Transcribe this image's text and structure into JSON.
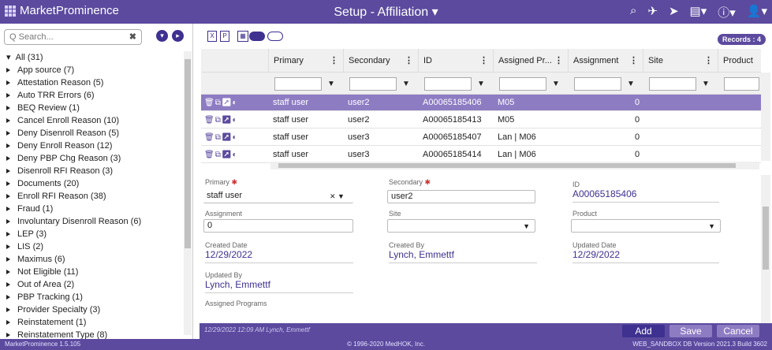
{
  "app": {
    "name": "MarketProminence",
    "page_title": "Setup - Affiliation"
  },
  "search": {
    "placeholder": "Q Search..."
  },
  "tree": {
    "root": "All (31)",
    "items": [
      "App source (7)",
      "Attestation Reason (5)",
      "Auto TRR Errors (6)",
      "BEQ Review (1)",
      "Cancel Enroll Reason (10)",
      "Deny Disenroll Reason (5)",
      "Deny Enroll Reason (12)",
      "Deny PBP Chg Reason (3)",
      "Disenroll RFI Reason (3)",
      "Documents (20)",
      "Enroll RFI Reason (38)",
      "Fraud (1)",
      "Involuntary Disenroll Reason (6)",
      "LEP (3)",
      "LIS (2)",
      "Maximus (6)",
      "Not Eligible (11)",
      "Out of Area (2)",
      "PBP Tracking (1)",
      "Provider Specialty (3)",
      "Reinstatement (1)",
      "Reinstatement Type (8)"
    ]
  },
  "grid": {
    "records_badge": "Records : 4",
    "columns": [
      "Primary",
      "Secondary",
      "ID",
      "Assigned Pr...",
      "Assignment",
      "Site",
      "Product"
    ],
    "rows": [
      {
        "primary": "staff user",
        "secondary": "user2",
        "id": "A00065185406",
        "programs": "M05",
        "assignment": "0"
      },
      {
        "primary": "staff user",
        "secondary": "user2",
        "id": "A00065185413",
        "programs": "M05",
        "assignment": "0"
      },
      {
        "primary": "staff user",
        "secondary": "user3",
        "id": "A00065185407",
        "programs": "Lan | M06",
        "assignment": "0"
      },
      {
        "primary": "staff user",
        "secondary": "user3",
        "id": "A00065185414",
        "programs": "Lan | M06",
        "assignment": "0"
      }
    ]
  },
  "form": {
    "primary_label": "Primary",
    "primary_value": "staff user",
    "secondary_label": "Secondary",
    "secondary_value": "user2",
    "id_label": "ID",
    "id_value": "A00065185406",
    "assignment_label": "Assignment",
    "assignment_value": "0",
    "site_label": "Site",
    "product_label": "Product",
    "created_date_label": "Created Date",
    "created_date": "12/29/2022",
    "created_by_label": "Created By",
    "created_by": "Lynch, Emmettf",
    "updated_date_label": "Updated Date",
    "updated_date": "12/29/2022",
    "updated_by_label": "Updated By",
    "updated_by": "Lynch, Emmettf",
    "assigned_programs_label": "Assigned Programs"
  },
  "bottom": {
    "meta": "12/29/2022 12:09 AM Lynch, Emmettf",
    "add": "Add",
    "save": "Save",
    "cancel": "Cancel"
  },
  "footer": {
    "version": "MarketProminence 1.5.105",
    "copyright": "© 1996-2020 MedHOK, Inc.",
    "db": "WEB_SANDBOX DB Version 2021.3 Build 3602"
  },
  "colors": {
    "brand": "#5b4a9e",
    "selected_row": "#8e7cc3",
    "accent": "#3e3190"
  }
}
